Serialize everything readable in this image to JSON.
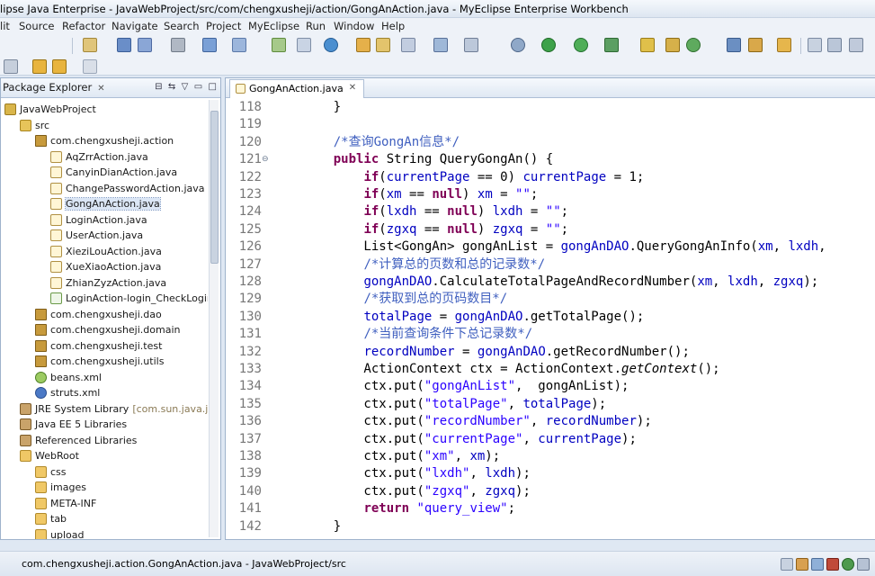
{
  "window": {
    "title": "lipse Java Enterprise - JavaWebProject/src/com/chengxusheji/action/GongAnAction.java - MyEclipse Enterprise Workbench"
  },
  "menu": [
    "lit",
    "Source",
    "Refactor",
    "Navigate",
    "Search",
    "Project",
    "MyEclipse",
    "Run",
    "Window",
    "Help"
  ],
  "package_explorer": {
    "tab_label": "Package Explorer",
    "tree": [
      {
        "label": "JavaWebProject",
        "icon": "project-icon",
        "indent": 0
      },
      {
        "label": "src",
        "icon": "source-folder-icon",
        "indent": 1
      },
      {
        "label": "com.chengxusheji.action",
        "icon": "package-icon",
        "indent": 2
      },
      {
        "label": "AqZrrAction.java",
        "icon": "java-file-icon",
        "indent": 3
      },
      {
        "label": "CanyinDianAction.java",
        "icon": "java-file-icon",
        "indent": 3
      },
      {
        "label": "ChangePasswordAction.java",
        "icon": "java-file-icon",
        "indent": 3
      },
      {
        "label": "GongAnAction.java",
        "icon": "java-file-icon",
        "indent": 3,
        "selected": true
      },
      {
        "label": "LoginAction.java",
        "icon": "java-file-icon",
        "indent": 3
      },
      {
        "label": "UserAction.java",
        "icon": "java-file-icon",
        "indent": 3
      },
      {
        "label": "XieziLouAction.java",
        "icon": "java-file-icon",
        "indent": 3
      },
      {
        "label": "XueXiaoAction.java",
        "icon": "java-file-icon",
        "indent": 3
      },
      {
        "label": "ZhianZyzAction.java",
        "icon": "java-file-icon",
        "indent": 3
      },
      {
        "label": "LoginAction-login_CheckLogin-",
        "icon": "xml-file-icon",
        "indent": 3
      },
      {
        "label": "com.chengxusheji.dao",
        "icon": "package-icon",
        "indent": 2
      },
      {
        "label": "com.chengxusheji.domain",
        "icon": "package-icon",
        "indent": 2
      },
      {
        "label": "com.chengxusheji.test",
        "icon": "package-icon",
        "indent": 2
      },
      {
        "label": "com.chengxusheji.utils",
        "icon": "package-icon",
        "indent": 2
      },
      {
        "label": "beans.xml",
        "icon": "spring-xml-icon",
        "indent": 2
      },
      {
        "label": "struts.xml",
        "icon": "gear-icon",
        "indent": 2
      },
      {
        "label": "JRE System Library",
        "extra": "[com.sun.java.jdk",
        "icon": "library-icon",
        "indent": 1
      },
      {
        "label": "Java EE 5 Libraries",
        "icon": "library-icon",
        "indent": 1
      },
      {
        "label": "Referenced Libraries",
        "icon": "library-icon",
        "indent": 1
      },
      {
        "label": "WebRoot",
        "icon": "folder-icon",
        "indent": 1
      },
      {
        "label": "css",
        "icon": "folder-icon",
        "indent": 2
      },
      {
        "label": "images",
        "icon": "folder-icon",
        "indent": 2
      },
      {
        "label": "META-INF",
        "icon": "folder-icon",
        "indent": 2
      },
      {
        "label": "tab",
        "icon": "folder-icon",
        "indent": 2
      },
      {
        "label": "upload",
        "icon": "folder-icon",
        "indent": 2
      }
    ]
  },
  "editor": {
    "tab_label": "GongAnAction.java",
    "lines": [
      {
        "n": "118",
        "tokens": [
          [
            "",
            "    }"
          ]
        ]
      },
      {
        "n": "119",
        "tokens": [
          [
            "",
            ""
          ]
        ]
      },
      {
        "n": "120",
        "tokens": [
          [
            "",
            "    "
          ],
          [
            "cmt",
            "/*查询GongAn信息*/"
          ]
        ]
      },
      {
        "n": "121",
        "fold": true,
        "tokens": [
          [
            "",
            "    "
          ],
          [
            "kw",
            "public"
          ],
          [
            "",
            " String QueryGongAn() {"
          ]
        ]
      },
      {
        "n": "122",
        "tokens": [
          [
            "",
            "        "
          ],
          [
            "kw",
            "if"
          ],
          [
            "",
            "("
          ],
          [
            "fld",
            "currentPage"
          ],
          [
            "",
            " == 0) "
          ],
          [
            "fld",
            "currentPage"
          ],
          [
            "",
            " = 1;"
          ]
        ]
      },
      {
        "n": "123",
        "tokens": [
          [
            "",
            "        "
          ],
          [
            "kw",
            "if"
          ],
          [
            "",
            "("
          ],
          [
            "fld",
            "xm"
          ],
          [
            "",
            " == "
          ],
          [
            "kw",
            "null"
          ],
          [
            "",
            ") "
          ],
          [
            "fld",
            "xm"
          ],
          [
            "",
            " = "
          ],
          [
            "str",
            "\"\""
          ],
          [
            "",
            ";"
          ]
        ]
      },
      {
        "n": "124",
        "tokens": [
          [
            "",
            "        "
          ],
          [
            "kw",
            "if"
          ],
          [
            "",
            "("
          ],
          [
            "fld",
            "lxdh"
          ],
          [
            "",
            " == "
          ],
          [
            "kw",
            "null"
          ],
          [
            "",
            ") "
          ],
          [
            "fld",
            "lxdh"
          ],
          [
            "",
            " = "
          ],
          [
            "str",
            "\"\""
          ],
          [
            "",
            ";"
          ]
        ]
      },
      {
        "n": "125",
        "tokens": [
          [
            "",
            "        "
          ],
          [
            "kw",
            "if"
          ],
          [
            "",
            "("
          ],
          [
            "fld",
            "zgxq"
          ],
          [
            "",
            " == "
          ],
          [
            "kw",
            "null"
          ],
          [
            "",
            ") "
          ],
          [
            "fld",
            "zgxq"
          ],
          [
            "",
            " = "
          ],
          [
            "str",
            "\"\""
          ],
          [
            "",
            ";"
          ]
        ]
      },
      {
        "n": "126",
        "tokens": [
          [
            "",
            "        List<GongAn> gongAnList = "
          ],
          [
            "fld",
            "gongAnDAO"
          ],
          [
            "",
            ".QueryGongAnInfo("
          ],
          [
            "fld",
            "xm"
          ],
          [
            "",
            ", "
          ],
          [
            "fld",
            "lxdh"
          ],
          [
            "",
            ","
          ]
        ]
      },
      {
        "n": "127",
        "tokens": [
          [
            "",
            "        "
          ],
          [
            "cmt",
            "/*计算总的页数和总的记录数*/"
          ]
        ]
      },
      {
        "n": "128",
        "tokens": [
          [
            "",
            "        "
          ],
          [
            "fld",
            "gongAnDAO"
          ],
          [
            "",
            ".CalculateTotalPageAndRecordNumber("
          ],
          [
            "fld",
            "xm"
          ],
          [
            "",
            ", "
          ],
          [
            "fld",
            "lxdh"
          ],
          [
            "",
            ", "
          ],
          [
            "fld",
            "zgxq"
          ],
          [
            "",
            ");"
          ]
        ]
      },
      {
        "n": "129",
        "tokens": [
          [
            "",
            "        "
          ],
          [
            "cmt",
            "/*获取到总的页码数目*/"
          ]
        ]
      },
      {
        "n": "130",
        "tokens": [
          [
            "",
            "        "
          ],
          [
            "fld",
            "totalPage"
          ],
          [
            "",
            " = "
          ],
          [
            "fld",
            "gongAnDAO"
          ],
          [
            "",
            ".getTotalPage();"
          ]
        ]
      },
      {
        "n": "131",
        "tokens": [
          [
            "",
            "        "
          ],
          [
            "cmt",
            "/*当前查询条件下总记录数*/"
          ]
        ]
      },
      {
        "n": "132",
        "tokens": [
          [
            "",
            "        "
          ],
          [
            "fld",
            "recordNumber"
          ],
          [
            "",
            " = "
          ],
          [
            "fld",
            "gongAnDAO"
          ],
          [
            "",
            ".getRecordNumber();"
          ]
        ]
      },
      {
        "n": "133",
        "tokens": [
          [
            "",
            "        ActionContext ctx = ActionContext."
          ],
          [
            "ita",
            "getContext"
          ],
          [
            "",
            "();"
          ]
        ]
      },
      {
        "n": "134",
        "tokens": [
          [
            "",
            "        ctx.put("
          ],
          [
            "str",
            "\"gongAnList\""
          ],
          [
            "",
            ",  gongAnList);"
          ]
        ]
      },
      {
        "n": "135",
        "tokens": [
          [
            "",
            "        ctx.put("
          ],
          [
            "str",
            "\"totalPage\""
          ],
          [
            "",
            ", "
          ],
          [
            "fld",
            "totalPage"
          ],
          [
            "",
            ");"
          ]
        ]
      },
      {
        "n": "136",
        "tokens": [
          [
            "",
            "        ctx.put("
          ],
          [
            "str",
            "\"recordNumber\""
          ],
          [
            "",
            ", "
          ],
          [
            "fld",
            "recordNumber"
          ],
          [
            "",
            ");"
          ]
        ]
      },
      {
        "n": "137",
        "tokens": [
          [
            "",
            "        ctx.put("
          ],
          [
            "str",
            "\"currentPage\""
          ],
          [
            "",
            ", "
          ],
          [
            "fld",
            "currentPage"
          ],
          [
            "",
            ");"
          ]
        ]
      },
      {
        "n": "138",
        "tokens": [
          [
            "",
            "        ctx.put("
          ],
          [
            "str",
            "\"xm\""
          ],
          [
            "",
            ", "
          ],
          [
            "fld",
            "xm"
          ],
          [
            "",
            ");"
          ]
        ]
      },
      {
        "n": "139",
        "tokens": [
          [
            "",
            "        ctx.put("
          ],
          [
            "str",
            "\"lxdh\""
          ],
          [
            "",
            ", "
          ],
          [
            "fld",
            "lxdh"
          ],
          [
            "",
            ");"
          ]
        ]
      },
      {
        "n": "140",
        "tokens": [
          [
            "",
            "        ctx.put("
          ],
          [
            "str",
            "\"zgxq\""
          ],
          [
            "",
            ", "
          ],
          [
            "fld",
            "zgxq"
          ],
          [
            "",
            ");"
          ]
        ]
      },
      {
        "n": "141",
        "tokens": [
          [
            "",
            "        "
          ],
          [
            "kw",
            "return"
          ],
          [
            "",
            " "
          ],
          [
            "str",
            "\"query_view\""
          ],
          [
            "",
            ";"
          ]
        ]
      },
      {
        "n": "142",
        "tokens": [
          [
            "",
            "    }"
          ]
        ]
      }
    ]
  },
  "statusbar": {
    "text": "com.chengxusheji.action.GongAnAction.java - JavaWebProject/src"
  },
  "colors": {
    "keyword": "#7f0055",
    "field": "#0000c0",
    "string": "#2a00ff",
    "comment": "#3f5fbf"
  }
}
